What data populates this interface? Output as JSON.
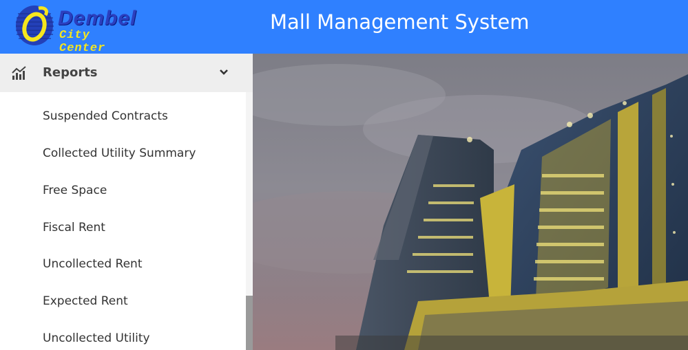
{
  "header": {
    "logo": {
      "line1": "Dembel",
      "line2": "City Center"
    },
    "title": "Mall Management System",
    "background_color": "#2f80ff"
  },
  "sidebar": {
    "section": {
      "label": "Reports",
      "icon": "chart-line-icon",
      "expand_icon": "chevron-down-icon"
    },
    "items": [
      {
        "label": "Suspended Contracts"
      },
      {
        "label": "Collected Utility Summary"
      },
      {
        "label": "Free Space"
      },
      {
        "label": "Fiscal Rent"
      },
      {
        "label": "Uncollected Rent"
      },
      {
        "label": "Expected Rent"
      },
      {
        "label": "Uncollected Utility"
      }
    ]
  },
  "main": {
    "hero_image": "building-photo"
  }
}
